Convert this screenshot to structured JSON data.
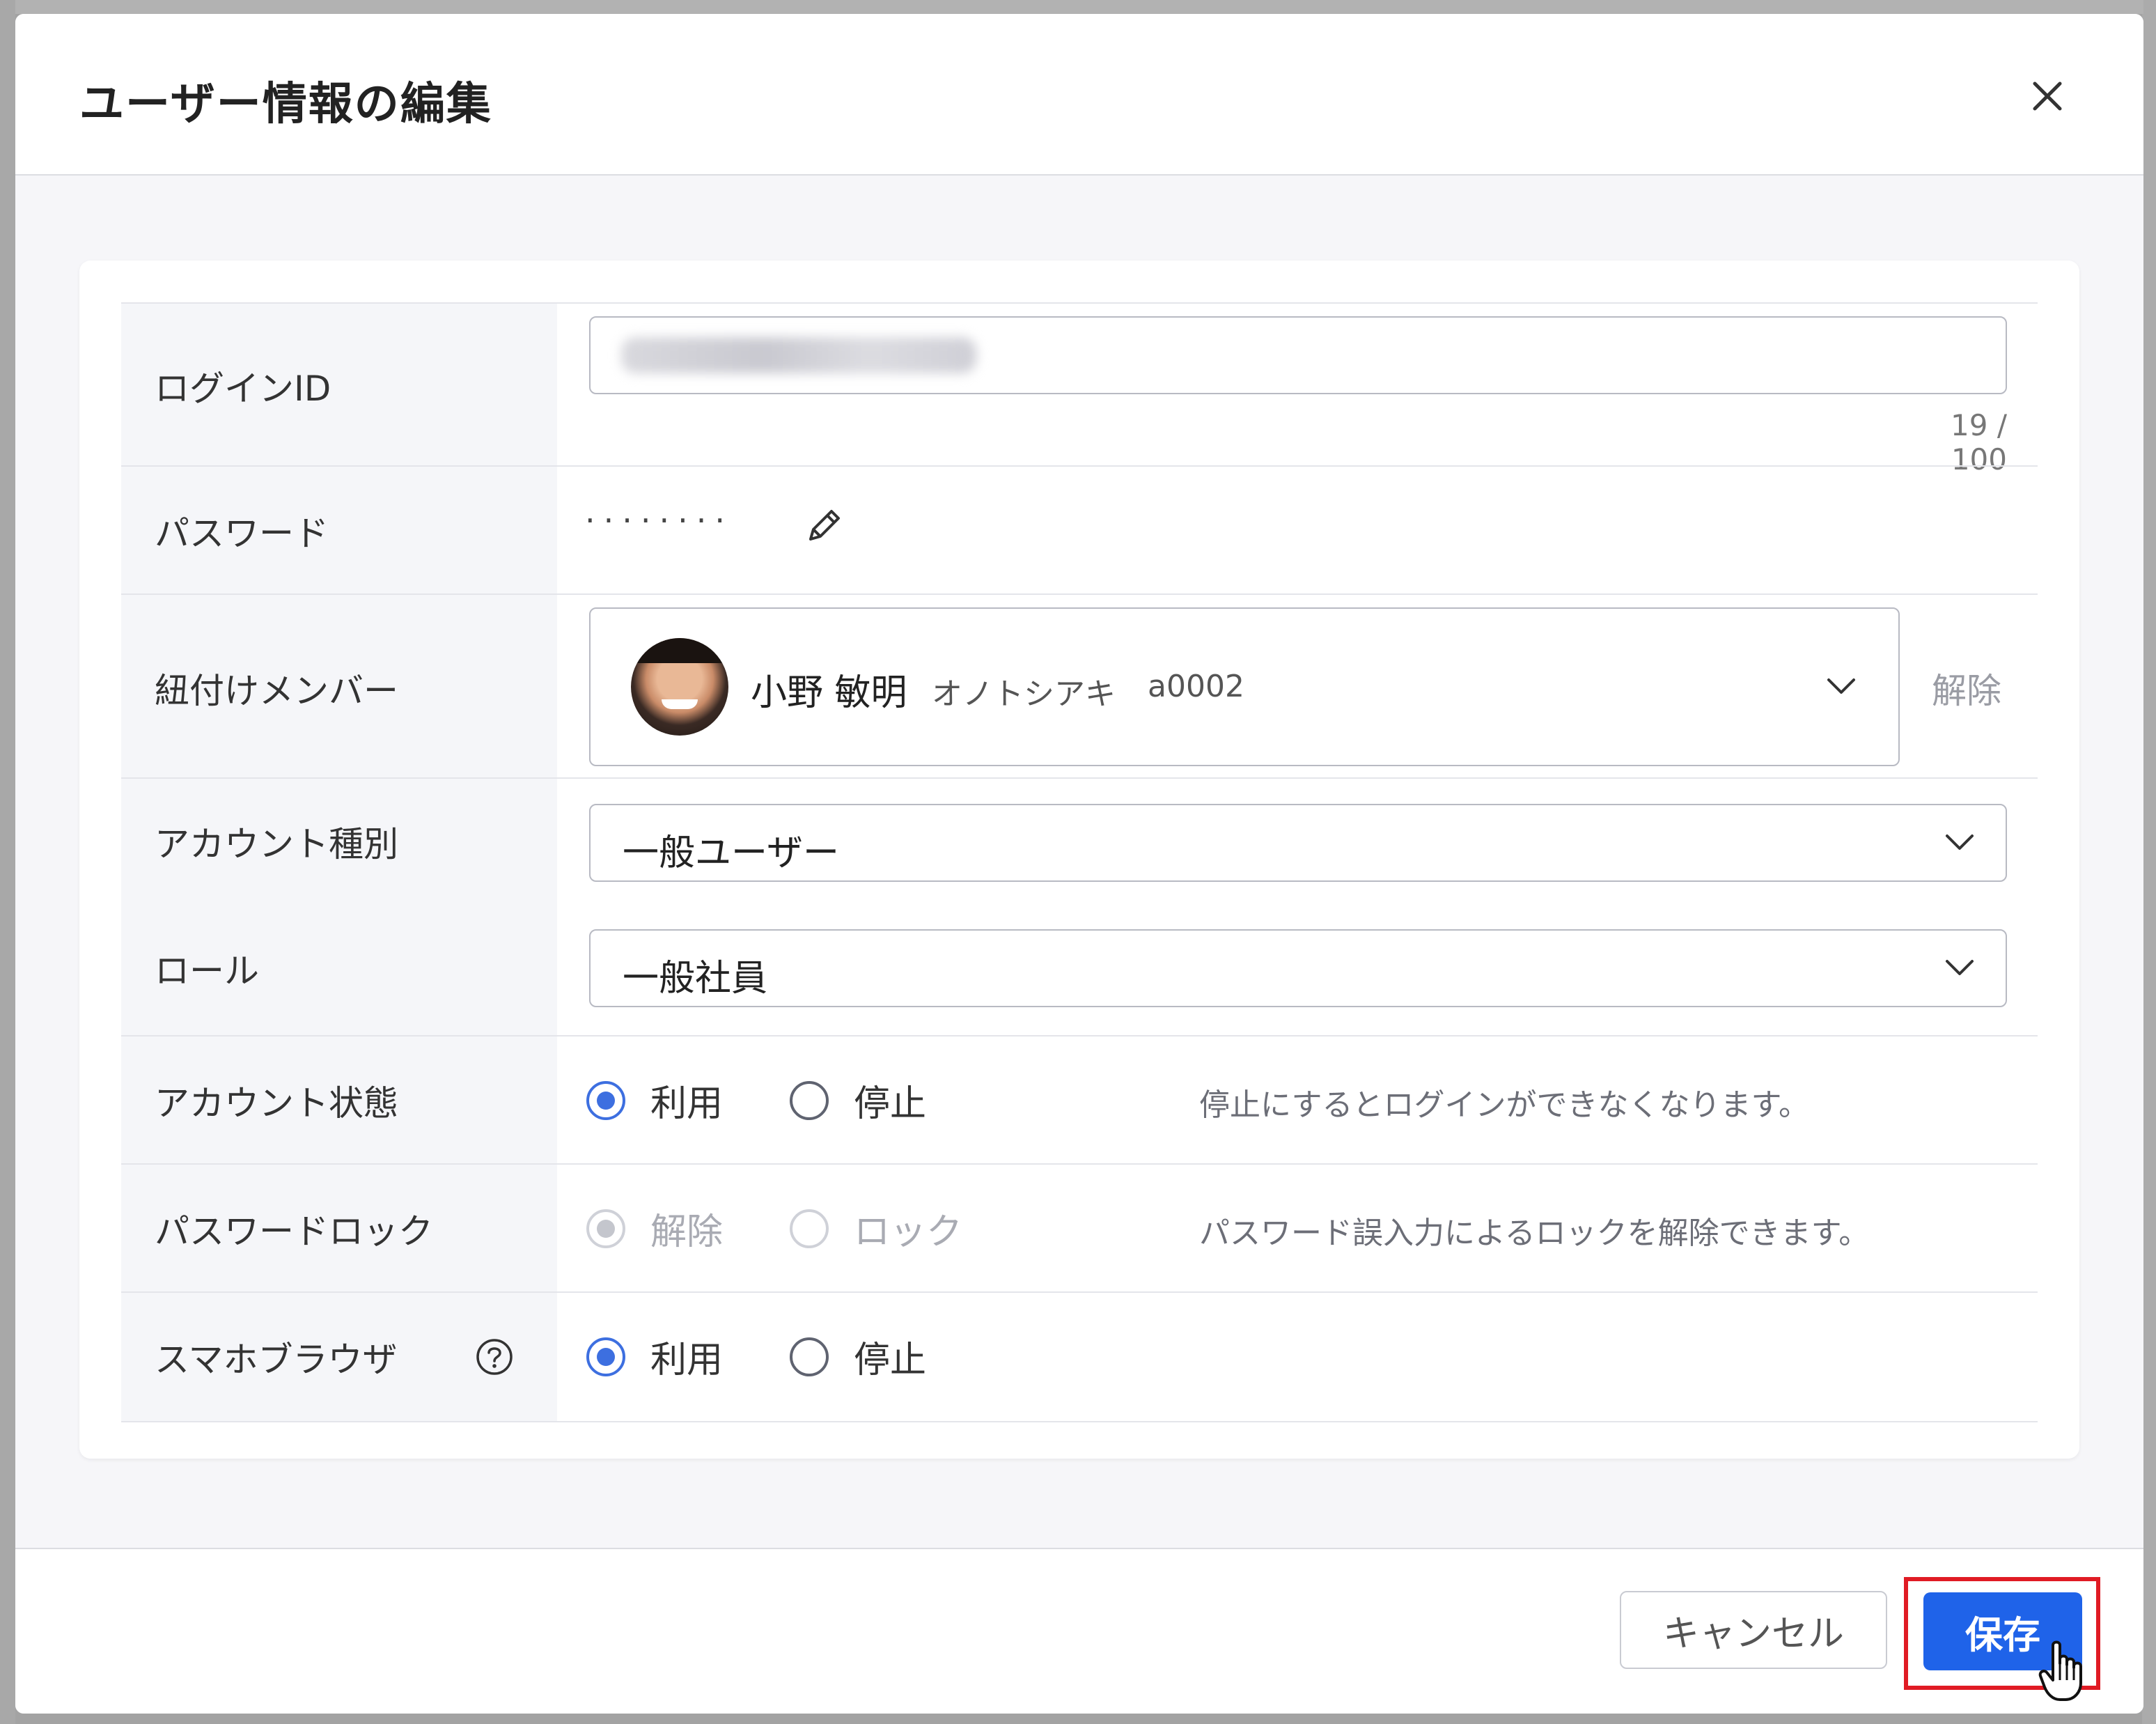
{
  "modal": {
    "title": "ユーザー情報の編集",
    "close_icon": "close-icon"
  },
  "form": {
    "login_id": {
      "label": "ログインID",
      "value_obscured": true,
      "counter": "19 / 100"
    },
    "password": {
      "label": "パスワード",
      "masked": "········",
      "edit_icon": "pencil-icon"
    },
    "member": {
      "label": "紐付けメンバー",
      "name": "小野 敏明",
      "kana": "オノトシアキ",
      "code": "a0002",
      "release_label": "解除"
    },
    "account_type": {
      "label": "アカウント種別",
      "value": "一般ユーザー"
    },
    "role": {
      "label": "ロール",
      "value": "一般社員"
    },
    "account_status": {
      "label": "アカウント状態",
      "options": [
        "利用",
        "停止"
      ],
      "selected": "利用",
      "hint": "停止にするとログインができなくなります。"
    },
    "password_lock": {
      "label": "パスワードロック",
      "options": [
        "解除",
        "ロック"
      ],
      "selected": "解除",
      "disabled": true,
      "hint": "パスワード誤入力によるロックを解除できます。"
    },
    "smartphone_browser": {
      "label": "スマホブラウザ",
      "help_icon": "question-circle-icon",
      "options": [
        "利用",
        "停止"
      ],
      "selected": "利用"
    }
  },
  "footer": {
    "cancel_label": "キャンセル",
    "save_label": "保存"
  },
  "colors": {
    "primary": "#1f63e9",
    "radio_checked": "#3d6fe0",
    "highlight": "#e01b24"
  }
}
